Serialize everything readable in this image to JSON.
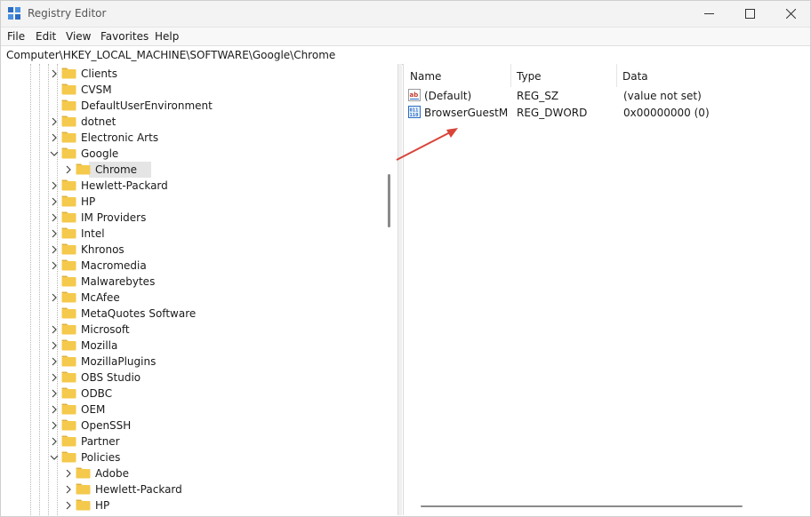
{
  "window": {
    "title": "Registry Editor",
    "icon": "registry-editor-icon",
    "controls": [
      "minimize",
      "maximize",
      "close"
    ]
  },
  "menu": {
    "file": "File",
    "edit": "Edit",
    "view": "View",
    "favorites": "Favorites",
    "help": "Help"
  },
  "address": {
    "path": "Computer\\HKEY_LOCAL_MACHINE\\SOFTWARE\\Google\\Chrome"
  },
  "tree": {
    "items": [
      {
        "label": "Clients",
        "level": 1,
        "expander": "collapsed"
      },
      {
        "label": "CVSM",
        "level": 1,
        "expander": "none"
      },
      {
        "label": "DefaultUserEnvironment",
        "level": 1,
        "expander": "none"
      },
      {
        "label": "dotnet",
        "level": 1,
        "expander": "collapsed"
      },
      {
        "label": "Electronic Arts",
        "level": 1,
        "expander": "collapsed"
      },
      {
        "label": "Google",
        "level": 1,
        "expander": "expanded"
      },
      {
        "label": "Chrome",
        "level": 2,
        "expander": "collapsed",
        "selected": true
      },
      {
        "label": "Hewlett-Packard",
        "level": 1,
        "expander": "collapsed"
      },
      {
        "label": "HP",
        "level": 1,
        "expander": "collapsed"
      },
      {
        "label": "IM Providers",
        "level": 1,
        "expander": "collapsed"
      },
      {
        "label": "Intel",
        "level": 1,
        "expander": "collapsed"
      },
      {
        "label": "Khronos",
        "level": 1,
        "expander": "collapsed"
      },
      {
        "label": "Macromedia",
        "level": 1,
        "expander": "collapsed"
      },
      {
        "label": "Malwarebytes",
        "level": 1,
        "expander": "none"
      },
      {
        "label": "McAfee",
        "level": 1,
        "expander": "collapsed"
      },
      {
        "label": "MetaQuotes Software",
        "level": 1,
        "expander": "none"
      },
      {
        "label": "Microsoft",
        "level": 1,
        "expander": "collapsed"
      },
      {
        "label": "Mozilla",
        "level": 1,
        "expander": "collapsed"
      },
      {
        "label": "MozillaPlugins",
        "level": 1,
        "expander": "collapsed"
      },
      {
        "label": "OBS Studio",
        "level": 1,
        "expander": "collapsed"
      },
      {
        "label": "ODBC",
        "level": 1,
        "expander": "collapsed"
      },
      {
        "label": "OEM",
        "level": 1,
        "expander": "collapsed"
      },
      {
        "label": "OpenSSH",
        "level": 1,
        "expander": "collapsed"
      },
      {
        "label": "Partner",
        "level": 1,
        "expander": "collapsed"
      },
      {
        "label": "Policies",
        "level": 1,
        "expander": "expanded"
      },
      {
        "label": "Adobe",
        "level": 2,
        "expander": "collapsed"
      },
      {
        "label": "Hewlett-Packard",
        "level": 2,
        "expander": "collapsed"
      },
      {
        "label": "HP",
        "level": 2,
        "expander": "collapsed"
      }
    ]
  },
  "list": {
    "columns": {
      "name": "Name",
      "type": "Type",
      "data": "Data"
    },
    "rows": [
      {
        "icon": "string-value-icon",
        "name": "(Default)",
        "type": "REG_SZ",
        "data": "(value not set)"
      },
      {
        "icon": "binary-value-icon",
        "name": "BrowserGuestM...",
        "type": "REG_DWORD",
        "data": "0x00000000 (0)"
      }
    ]
  },
  "colors": {
    "folder": "#f4c94c",
    "selection": "#e5e5e5",
    "annotation_arrow": "#d9453a"
  }
}
